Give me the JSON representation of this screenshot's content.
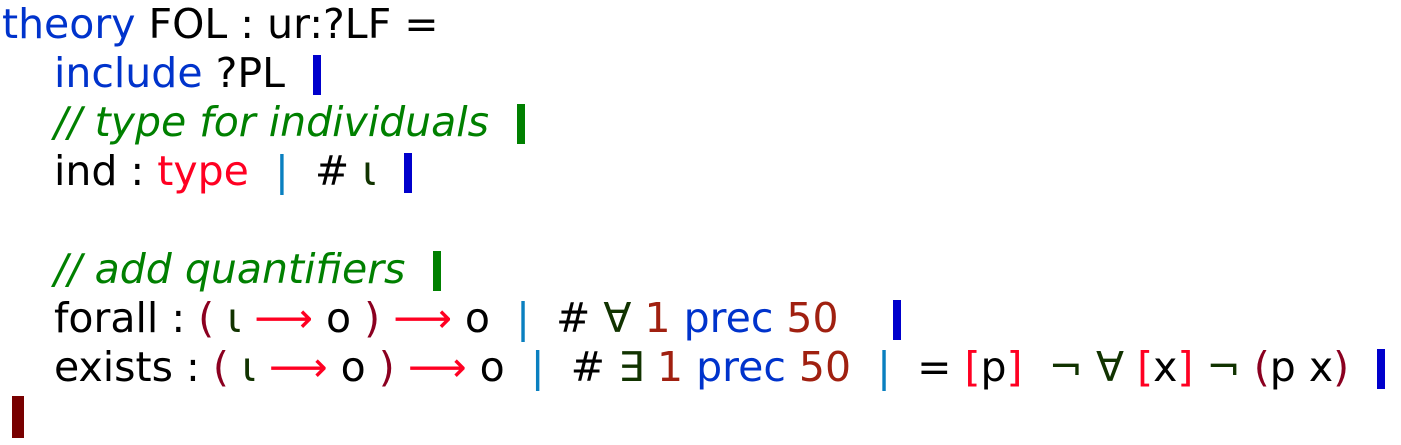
{
  "lines": [
    {
      "indent": false,
      "tokens": [
        {
          "t": "theory",
          "k": "kw"
        },
        {
          "t": " FOL : ur:?LF =",
          "k": "plain"
        }
      ]
    },
    {
      "indent": true,
      "tokens": [
        {
          "t": "include",
          "k": "kw"
        },
        {
          "t": " ?PL  ",
          "k": "plain"
        },
        {
          "bar": "decl"
        }
      ]
    },
    {
      "indent": true,
      "tokens": [
        {
          "t": "// type for individuals  ",
          "k": "comment"
        },
        {
          "bar": "comment"
        }
      ]
    },
    {
      "indent": true,
      "tokens": [
        {
          "t": "ind : ",
          "k": "plain"
        },
        {
          "t": "type",
          "k": "type"
        },
        {
          "t": "  ",
          "k": "plain"
        },
        {
          "t": "|",
          "k": "sep"
        },
        {
          "t": "  # ",
          "k": "plain"
        },
        {
          "t": "ι",
          "k": "sym"
        },
        {
          "t": "  ",
          "k": "plain"
        },
        {
          "bar": "decl"
        }
      ]
    },
    {
      "indent": true,
      "tokens": []
    },
    {
      "indent": true,
      "tokens": [
        {
          "t": "// add quantifiers  ",
          "k": "comment"
        },
        {
          "bar": "comment"
        }
      ]
    },
    {
      "indent": true,
      "tokens": [
        {
          "t": "forall : ",
          "k": "plain"
        },
        {
          "t": "(",
          "k": "paren"
        },
        {
          "t": " ι ",
          "k": "sym"
        },
        {
          "t": "⟶",
          "k": "arrow"
        },
        {
          "t": " o ",
          "k": "plain"
        },
        {
          "t": ")",
          "k": "paren"
        },
        {
          "t": " ",
          "k": "plain"
        },
        {
          "t": "⟶",
          "k": "arrow"
        },
        {
          "t": " o  ",
          "k": "plain"
        },
        {
          "t": "|",
          "k": "sep"
        },
        {
          "t": "  # ",
          "k": "plain"
        },
        {
          "t": "∀",
          "k": "sym"
        },
        {
          "t": " ",
          "k": "plain"
        },
        {
          "t": "1",
          "k": "num"
        },
        {
          "t": " ",
          "k": "plain"
        },
        {
          "t": "prec",
          "k": "kw"
        },
        {
          "t": " ",
          "k": "plain"
        },
        {
          "t": "50",
          "k": "num"
        },
        {
          "t": "    ",
          "k": "plain"
        },
        {
          "bar": "decl"
        }
      ]
    },
    {
      "indent": true,
      "tokens": [
        {
          "t": "exists : ",
          "k": "plain"
        },
        {
          "t": "(",
          "k": "paren"
        },
        {
          "t": " ι ",
          "k": "sym"
        },
        {
          "t": "⟶",
          "k": "arrow"
        },
        {
          "t": " o ",
          "k": "plain"
        },
        {
          "t": ")",
          "k": "paren"
        },
        {
          "t": " ",
          "k": "plain"
        },
        {
          "t": "⟶",
          "k": "arrow"
        },
        {
          "t": " o  ",
          "k": "plain"
        },
        {
          "t": "|",
          "k": "sep"
        },
        {
          "t": "  # ",
          "k": "plain"
        },
        {
          "t": "∃",
          "k": "sym"
        },
        {
          "t": " ",
          "k": "plain"
        },
        {
          "t": "1",
          "k": "num"
        },
        {
          "t": " ",
          "k": "plain"
        },
        {
          "t": "prec",
          "k": "kw"
        },
        {
          "t": " ",
          "k": "plain"
        },
        {
          "t": "50",
          "k": "num"
        },
        {
          "t": "  ",
          "k": "plain"
        },
        {
          "t": "|",
          "k": "sep"
        },
        {
          "t": "  = ",
          "k": "plain"
        },
        {
          "t": "[",
          "k": "bracket"
        },
        {
          "t": "p",
          "k": "plain"
        },
        {
          "t": "]",
          "k": "bracket"
        },
        {
          "t": "  ",
          "k": "plain"
        },
        {
          "t": "¬",
          "k": "sym"
        },
        {
          "t": " ",
          "k": "plain"
        },
        {
          "t": "∀",
          "k": "sym"
        },
        {
          "t": " ",
          "k": "plain"
        },
        {
          "t": "[",
          "k": "bracket"
        },
        {
          "t": "x",
          "k": "plain"
        },
        {
          "t": "]",
          "k": "bracket"
        },
        {
          "t": " ",
          "k": "plain"
        },
        {
          "t": "¬",
          "k": "sym"
        },
        {
          "t": " ",
          "k": "plain"
        },
        {
          "t": "(",
          "k": "paren"
        },
        {
          "t": "p x",
          "k": "plain"
        },
        {
          "t": ")",
          "k": "paren"
        },
        {
          "t": "  ",
          "k": "plain"
        },
        {
          "bar": "decl"
        }
      ]
    },
    {
      "indent": false,
      "tokens": [
        {
          "bar": "module"
        }
      ]
    }
  ]
}
